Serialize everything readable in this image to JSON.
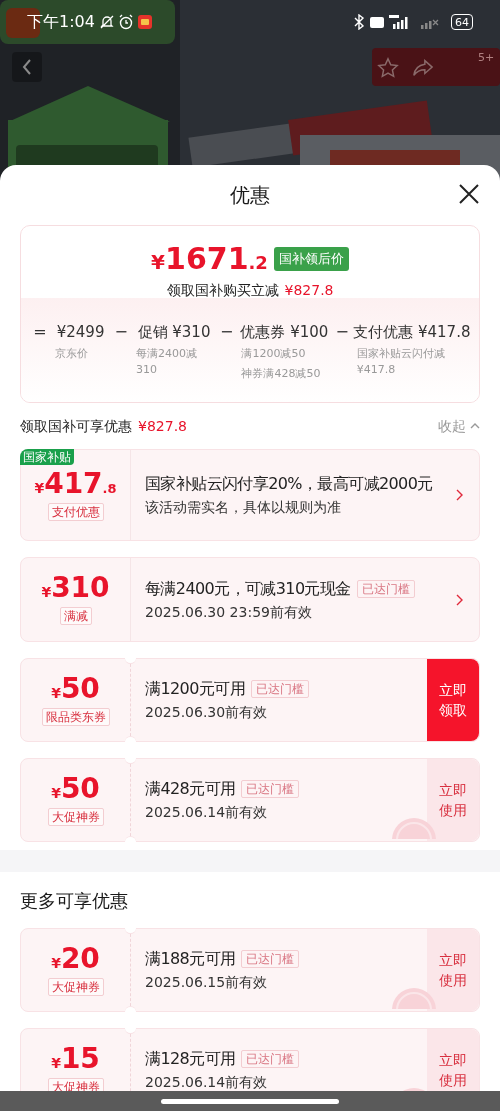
{
  "status_bar": {
    "time": "下午1:04",
    "battery": "64"
  },
  "header_badge": "5+",
  "sheet": {
    "title": "优惠"
  },
  "summary": {
    "price_currency": "¥",
    "price_integer": "1671",
    "price_decimal": ".2",
    "price_tag": "国补领后价",
    "saving_label": "领取国补购买立减",
    "saving_amount": "¥827.8",
    "breakdown": [
      {
        "operator": "=",
        "value": "¥2499",
        "notes": [
          "京东价"
        ]
      },
      {
        "operator": "−",
        "value": "促销 ¥310",
        "notes": [
          "每满2400减310"
        ]
      },
      {
        "operator": "−",
        "value": "优惠券 ¥100",
        "notes": [
          "满1200减50",
          "神券满428减50"
        ]
      },
      {
        "operator": "−",
        "value": "支付优惠 ¥417.8",
        "notes": [
          "国家补贴云闪付减¥417.8"
        ]
      }
    ]
  },
  "section": {
    "title": "领取国补可享优惠",
    "amount": "¥827.8",
    "toggle": "收起",
    "offers": [
      {
        "kind": "offer",
        "badge": "国家补贴",
        "currency": "¥",
        "amount": "417",
        "decimal": ".8",
        "tag": "支付优惠",
        "title": "国家补贴云闪付享20%，最高可减2000元",
        "detail": "该活动需实名，具体以规则为准",
        "action": {
          "kind": "arrow"
        }
      },
      {
        "kind": "offer",
        "currency": "¥",
        "amount": "310",
        "tag": "满减",
        "title": "每满2400元，可减310元现金",
        "status": "已达门槛",
        "detail": "2025.06.30 23:59前有效",
        "action": {
          "kind": "arrow"
        }
      },
      {
        "kind": "coupon",
        "currency": "¥",
        "amount": "50",
        "tag": "限品类东券",
        "title": "满1200元可用",
        "status": "已达门槛",
        "detail": "2025.06.30前有效",
        "stamped": false,
        "action": {
          "kind": "button",
          "label": "立即领取",
          "primary": true
        }
      },
      {
        "kind": "coupon",
        "currency": "¥",
        "amount": "50",
        "tag": "大促神券",
        "title": "满428元可用",
        "status": "已达门槛",
        "detail": "2025.06.14前有效",
        "stamped": true,
        "action": {
          "kind": "button",
          "label": "立即使用",
          "primary": false
        }
      }
    ]
  },
  "more_section": {
    "title": "更多可享优惠",
    "offers": [
      {
        "kind": "coupon",
        "currency": "¥",
        "amount": "20",
        "tag": "大促神券",
        "title": "满188元可用",
        "status": "已达门槛",
        "detail": "2025.06.15前有效",
        "stamped": true,
        "action": {
          "kind": "button",
          "label": "立即使用",
          "primary": false
        }
      },
      {
        "kind": "coupon",
        "currency": "¥",
        "amount": "15",
        "tag": "大促神券",
        "title": "满128元可用",
        "status": "已达门槛",
        "detail": "2025.06.14前有效",
        "stamped": true,
        "action": {
          "kind": "button",
          "label": "立即使用",
          "primary": false
        }
      }
    ]
  }
}
